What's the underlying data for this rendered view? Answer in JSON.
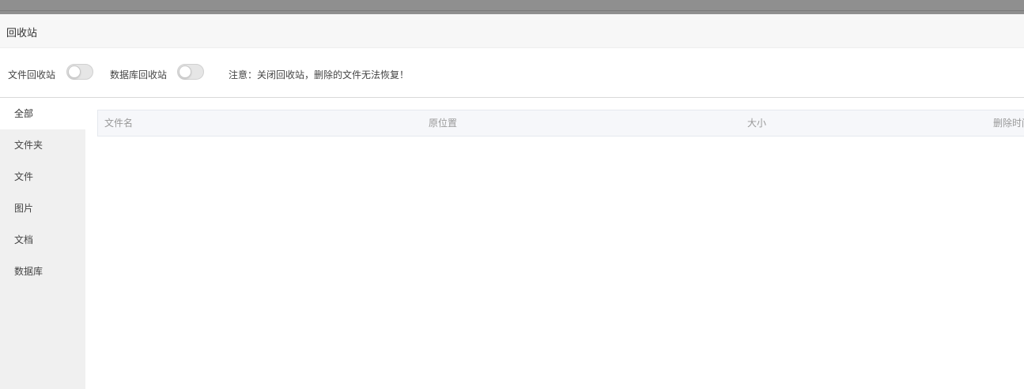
{
  "background_table": {
    "note": ""
  },
  "dialog": {
    "title": "回收站"
  },
  "settings": {
    "file_recycle_label": "文件回收站",
    "file_recycle_enabled": false,
    "db_recycle_label": "数据库回收站",
    "db_recycle_enabled": false,
    "notice": "注意：关闭回收站，删除的文件无法恢复！"
  },
  "sidebar": {
    "items": [
      {
        "label": "全部",
        "active": true
      },
      {
        "label": "文件夹",
        "active": false
      },
      {
        "label": "文件",
        "active": false
      },
      {
        "label": "图片",
        "active": false
      },
      {
        "label": "文档",
        "active": false
      },
      {
        "label": "数据库",
        "active": false
      }
    ]
  },
  "table": {
    "columns": [
      {
        "label": "文件名"
      },
      {
        "label": "原位置"
      },
      {
        "label": "大小"
      },
      {
        "label": "删除时间"
      }
    ],
    "rows": []
  },
  "colors": {
    "header_bg": "#f7f7f7",
    "sidebar_bg": "#f0f0f0",
    "table_header_bg": "#f6f7fa",
    "toggle_off": "#e6e6e6"
  }
}
